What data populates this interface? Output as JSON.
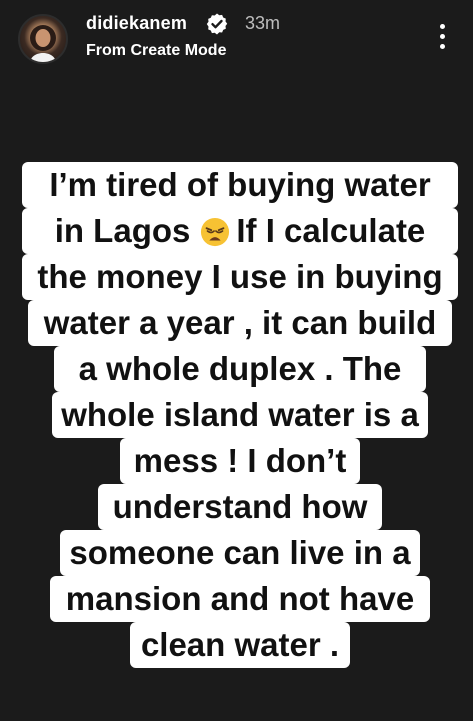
{
  "header": {
    "username": "didiekanem",
    "time_ago": "33m",
    "subtitle": "From Create Mode",
    "verified_icon": "verified-badge-icon",
    "more_icon": "more-vertical-icon"
  },
  "story": {
    "lines": [
      "I’m tired of buying water",
      "in Lagos",
      "If I calculate",
      "the money I use in buying",
      "water a year , it can build",
      "a whole duplex .    The",
      "whole island water is a",
      "mess !  I don’t",
      "understand how",
      "someone can live in a",
      "mansion and not have",
      "clean water ."
    ],
    "emoji": "weary-face-emoji"
  },
  "colors": {
    "background": "#1b1b1b",
    "text_box": "#ffffff",
    "text": "#111111",
    "emoji": "#f7c233"
  }
}
